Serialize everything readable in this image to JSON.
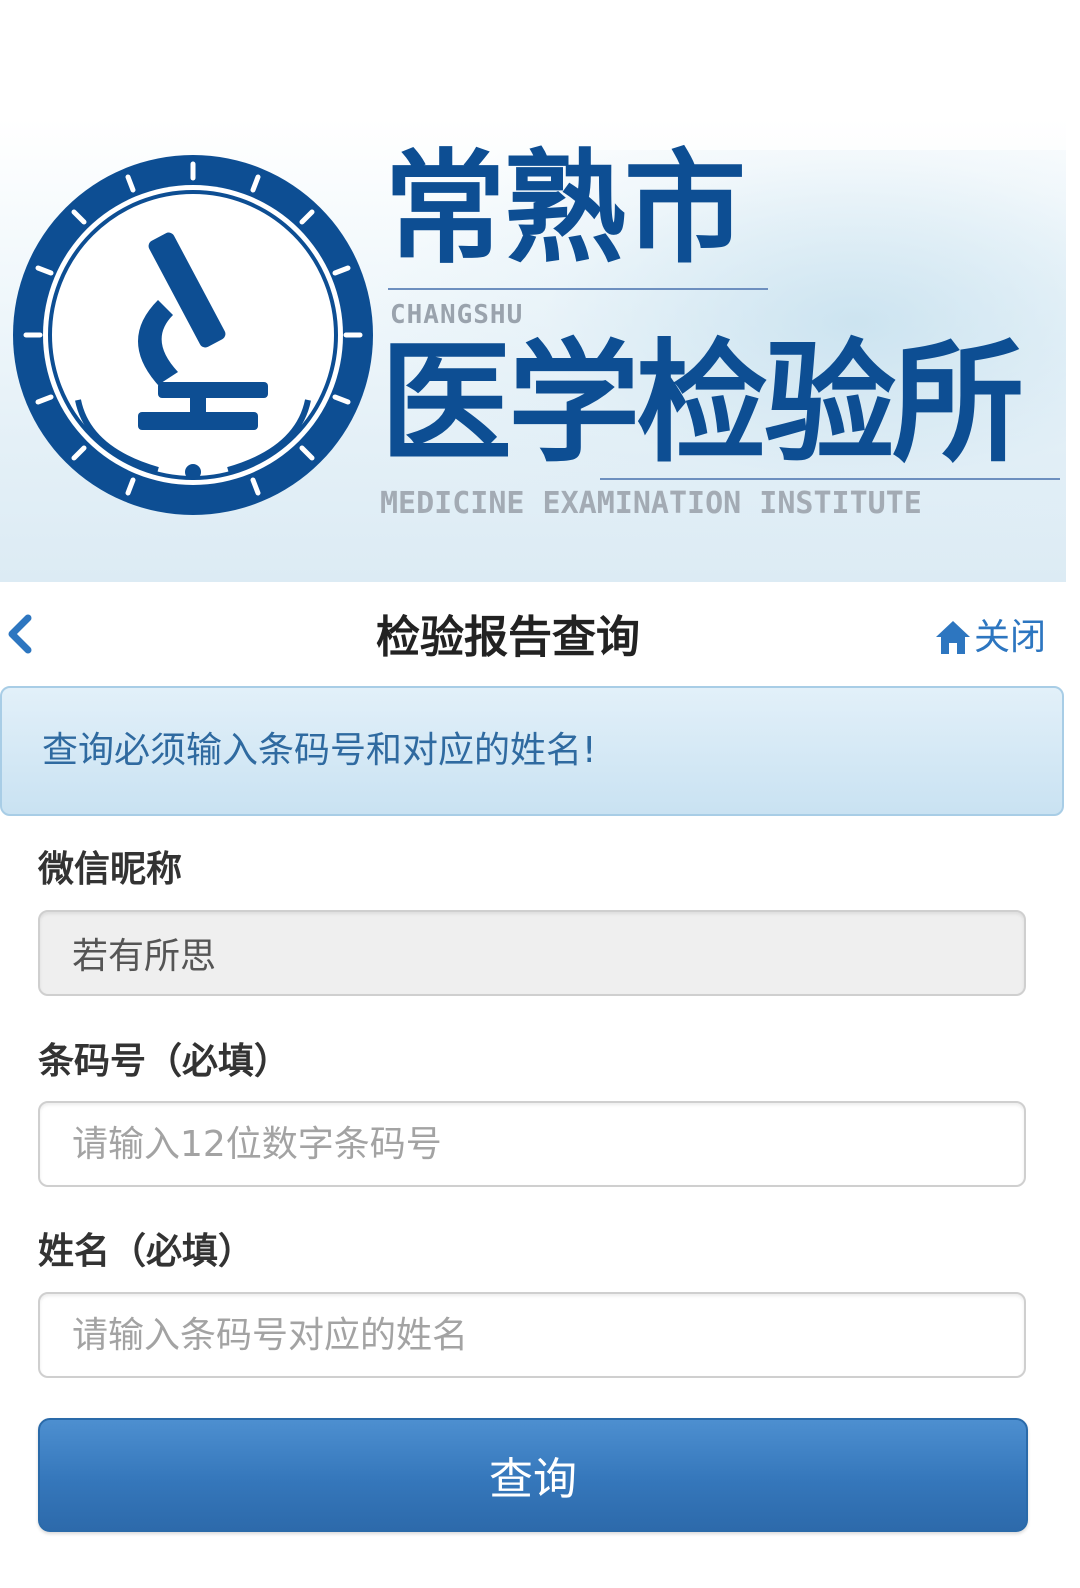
{
  "banner": {
    "city": "常熟市",
    "pinyin": "CHANGSHU",
    "institute": "医学检验所",
    "english": "MEDICINE EXAMINATION INSTITUTE",
    "logo_icon": "microscope-seal-logo"
  },
  "navbar": {
    "title": "检验报告查询",
    "back_icon": "chevron-left-icon",
    "close_icon": "home-icon",
    "close_label": "关闭"
  },
  "alert": {
    "message": "查询必须输入条码号和对应的姓名!"
  },
  "form": {
    "nickname": {
      "label": "微信昵称",
      "value": "若有所思"
    },
    "barcode": {
      "label": "条码号（必填）",
      "placeholder": "请输入12位数字条码号"
    },
    "name": {
      "label": "姓名（必填）",
      "placeholder": "请输入条码号对应的姓名"
    },
    "submit_label": "查询"
  },
  "colors": {
    "brand_blue": "#0d4e93",
    "link_blue": "#2d76c0",
    "alert_bg": "#d6e9f6",
    "button_blue": "#3577bb"
  }
}
